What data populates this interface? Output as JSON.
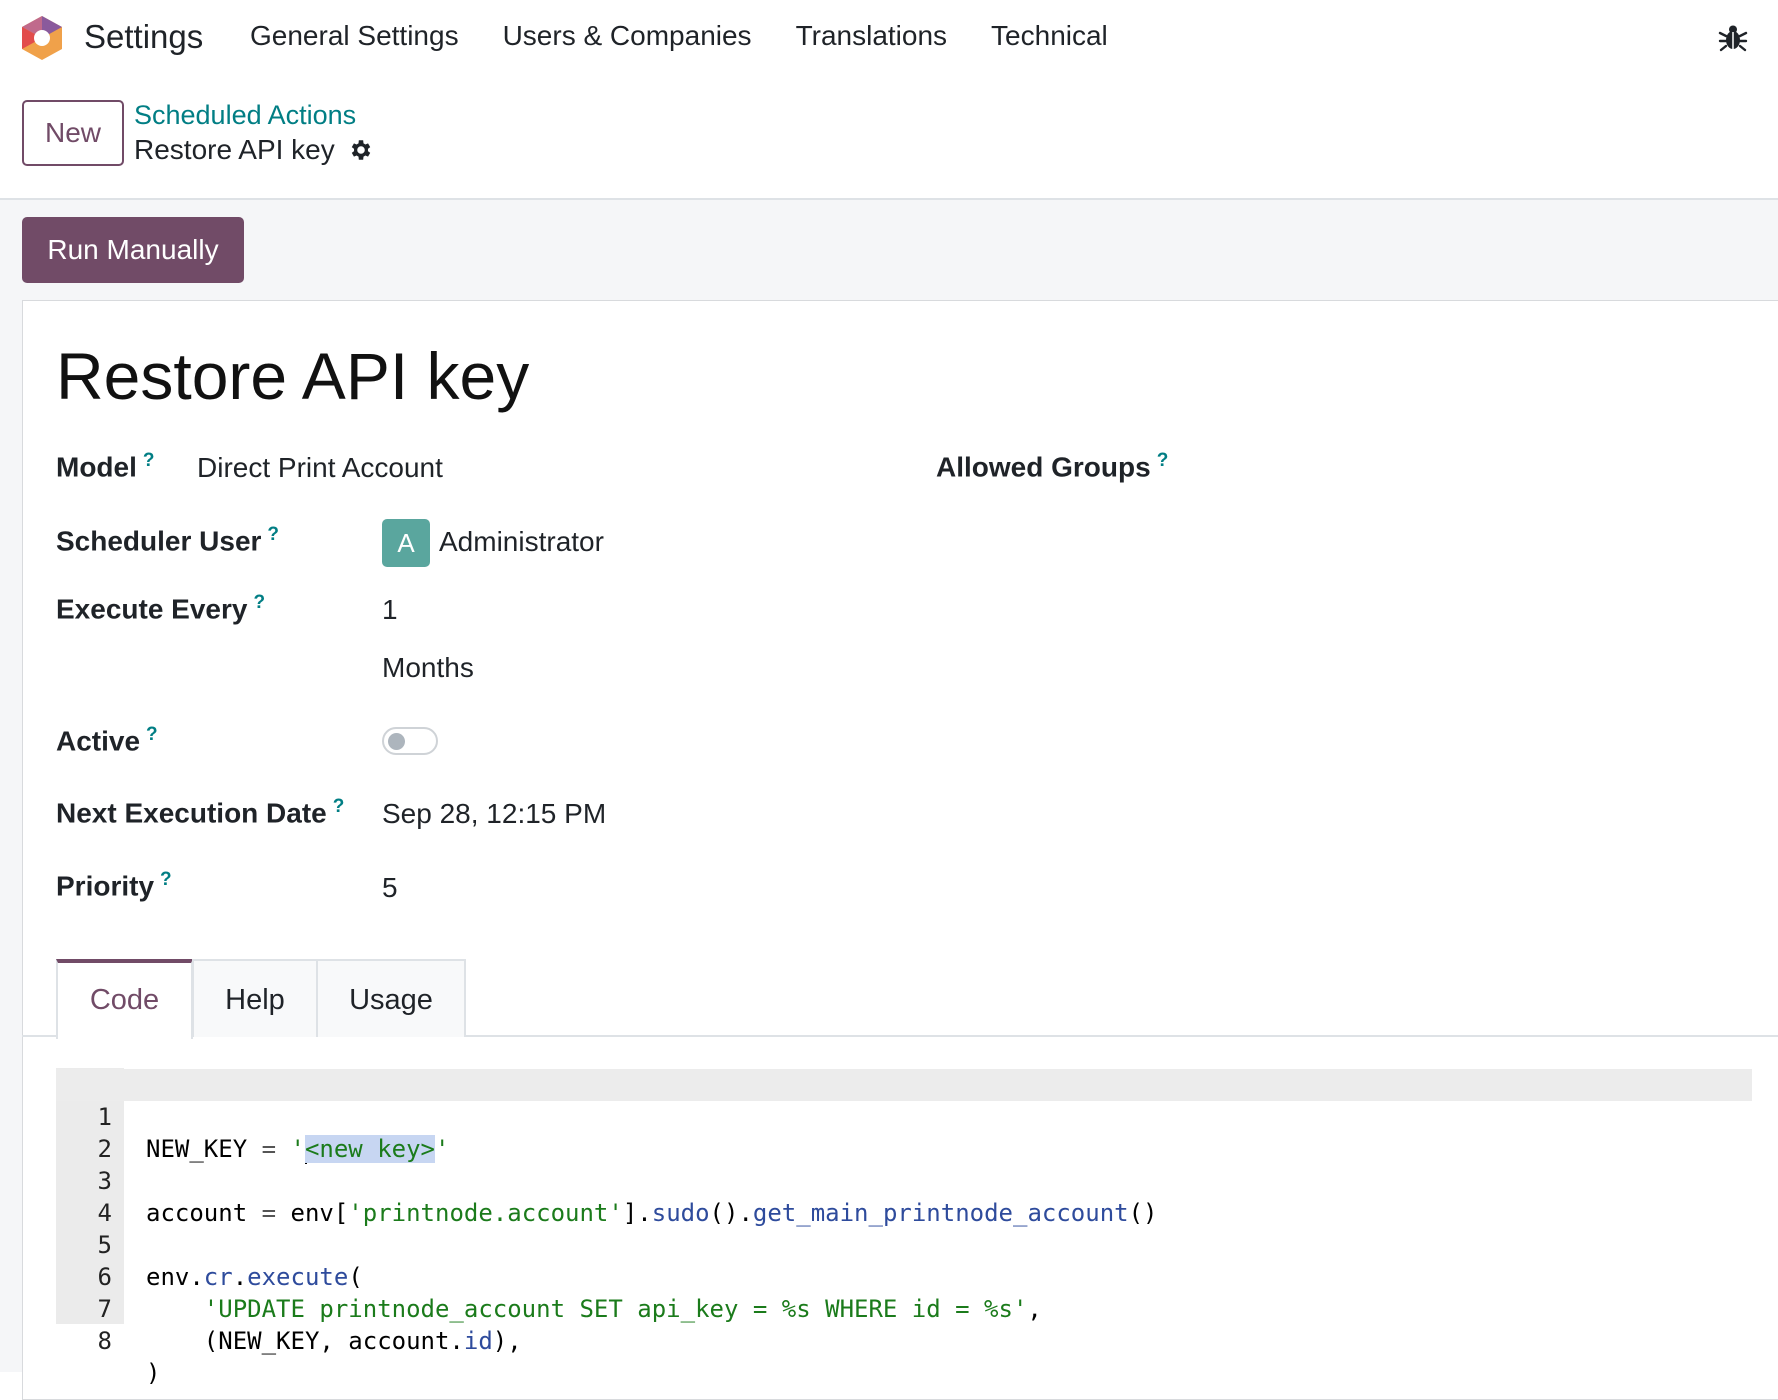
{
  "navbar": {
    "app_name": "Settings",
    "menu": [
      "General Settings",
      "Users & Companies",
      "Translations",
      "Technical"
    ],
    "debug_icon": "bug-icon"
  },
  "control_panel": {
    "new_label": "New",
    "breadcrumb_parent": "Scheduled Actions",
    "breadcrumb_current": "Restore API key",
    "gear_icon": "gear-icon"
  },
  "actions": {
    "run_manually": "Run Manually"
  },
  "form": {
    "title": "Restore API key",
    "help_mark": "?",
    "fields": {
      "model": {
        "label": "Model",
        "value": "Direct Print Account"
      },
      "allowed_groups": {
        "label": "Allowed Groups",
        "value": ""
      },
      "scheduler_user": {
        "label": "Scheduler User",
        "avatar_letter": "A",
        "value": "Administrator"
      },
      "execute_every": {
        "label": "Execute Every",
        "value": "1",
        "unit": "Months"
      },
      "active": {
        "label": "Active",
        "checked": false
      },
      "next_execution_date": {
        "label": "Next Execution Date",
        "value": "Sep 28, 12:15 PM"
      },
      "priority": {
        "label": "Priority",
        "value": "5"
      }
    }
  },
  "tabs": [
    {
      "label": "Code",
      "active": true
    },
    {
      "label": "Help",
      "active": false
    },
    {
      "label": "Usage",
      "active": false
    }
  ],
  "code": {
    "line_numbers": [
      "1",
      "2",
      "3",
      "4",
      "5",
      "6",
      "7",
      "8"
    ],
    "lines": [
      "NEW_KEY = '<new key>'",
      "",
      "account = env['printnode.account'].sudo().get_main_printnode_account()",
      "",
      "env.cr.execute(",
      "    'UPDATE printnode_account SET api_key = %s WHERE id = %s',",
      "    (NEW_KEY, account.id),",
      ")"
    ]
  },
  "colors": {
    "brand": "#714b67",
    "link": "#017e84",
    "avatar": "#5aa69e",
    "code_string": "#1b7b1b"
  }
}
